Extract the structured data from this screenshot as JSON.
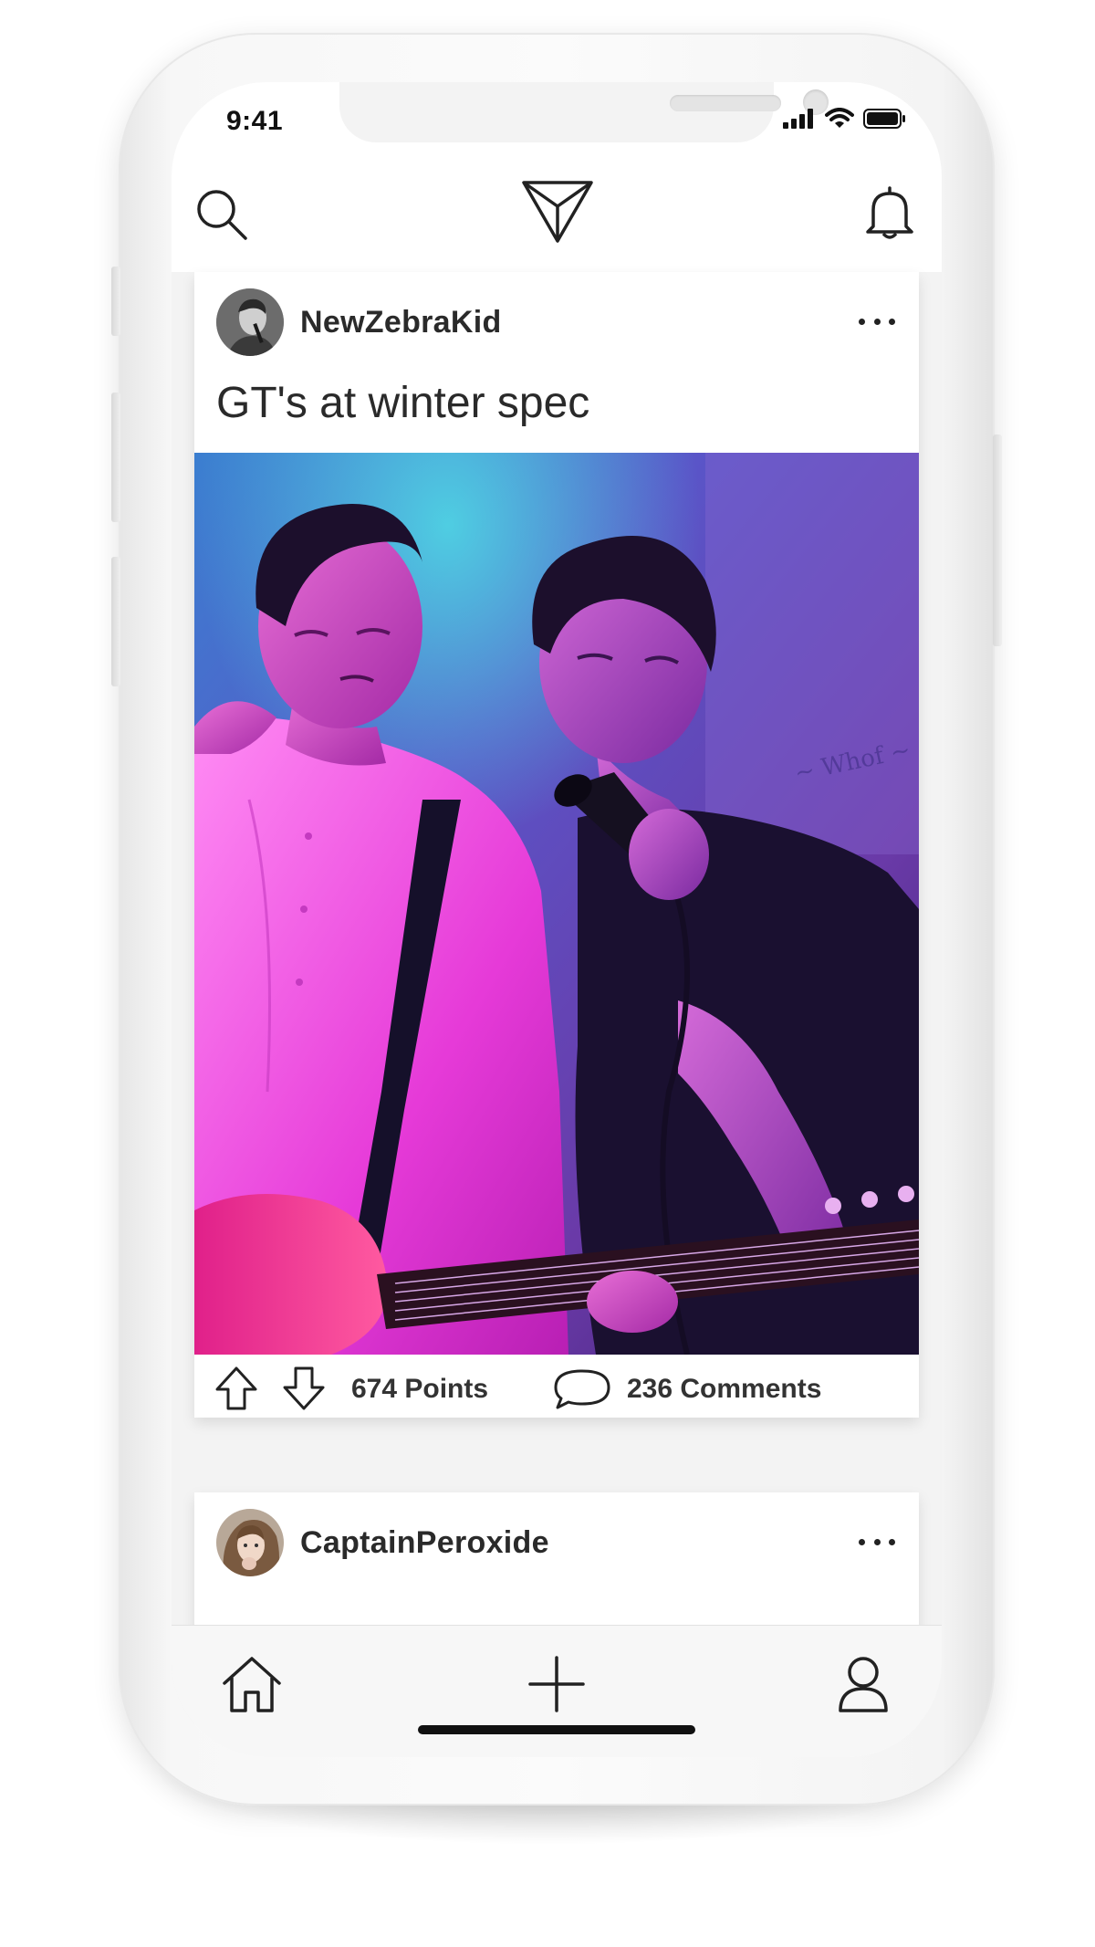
{
  "status_bar": {
    "time": "9:41"
  },
  "nav": {
    "search_icon": "search-icon",
    "logo_icon": "triangle-logo-icon",
    "bell_icon": "bell-icon"
  },
  "posts": [
    {
      "username": "NewZebraKid",
      "title": "GT's at winter spec",
      "points": "674 Points",
      "comments": "236 Comments"
    },
    {
      "username": "CaptainPeroxide",
      "title": ""
    }
  ],
  "tab_bar": {
    "home_icon": "home-icon",
    "add_icon": "plus-icon",
    "profile_icon": "user-icon"
  },
  "colors": {
    "phone_frame": "#f7f7f7",
    "screen_background": "#f3f3f3",
    "card_background": "#ffffff",
    "text_primary": "#2a2a2a",
    "photo_magenta": "#e63ad8",
    "photo_violet": "#5a2fa0"
  }
}
